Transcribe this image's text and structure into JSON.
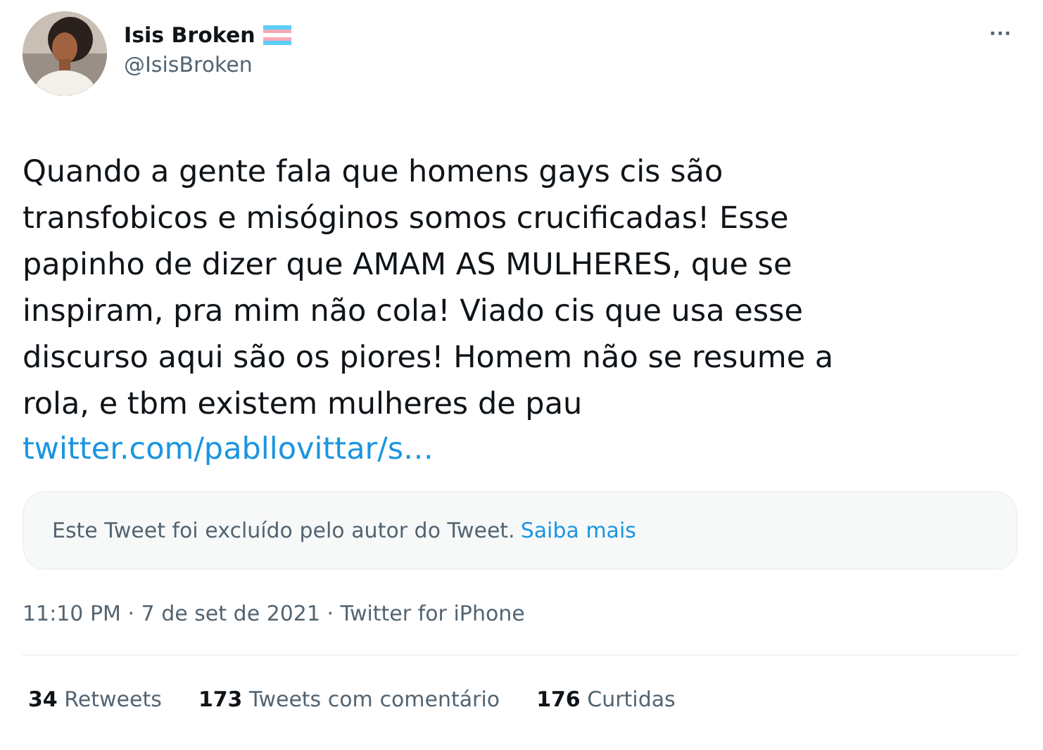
{
  "author": {
    "name": "Isis Broken",
    "handle": "@IsisBroken"
  },
  "more_button": "···",
  "text": "Quando a gente fala que homens gays cis são\ntransfobicos e misóginos somos crucificadas! Esse\npapinho de dizer que AMAM AS MULHERES, que se\ninspiram, pra mim não cola! Viado cis que usa esse\ndiscurso aqui são os piores! Homem não se resume a\nrola, e tbm existem mulheres de pau",
  "link": "twitter.com/pabllovittar/s…",
  "quoted_notice": {
    "text": "Este Tweet foi excluído pelo autor do Tweet.",
    "link": "Saiba mais"
  },
  "meta": "11:10 PM · 7 de set de 2021 · Twitter for iPhone",
  "stats": [
    {
      "count": "34",
      "label": "Retweets"
    },
    {
      "count": "173",
      "label": "Tweets com comentário"
    },
    {
      "count": "176",
      "label": "Curtidas"
    }
  ]
}
